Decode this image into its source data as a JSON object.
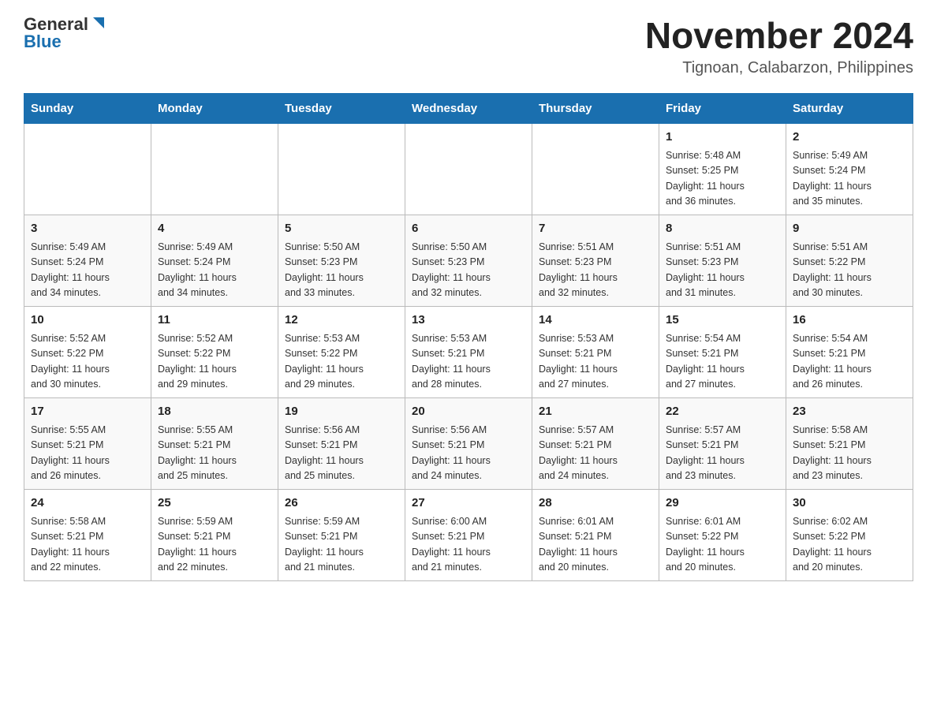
{
  "header": {
    "logo_general": "General",
    "logo_blue": "Blue",
    "main_title": "November 2024",
    "subtitle": "Tignoan, Calabarzon, Philippines"
  },
  "days_of_week": [
    "Sunday",
    "Monday",
    "Tuesday",
    "Wednesday",
    "Thursday",
    "Friday",
    "Saturday"
  ],
  "weeks": [
    {
      "days": [
        {
          "num": "",
          "info": ""
        },
        {
          "num": "",
          "info": ""
        },
        {
          "num": "",
          "info": ""
        },
        {
          "num": "",
          "info": ""
        },
        {
          "num": "",
          "info": ""
        },
        {
          "num": "1",
          "info": "Sunrise: 5:48 AM\nSunset: 5:25 PM\nDaylight: 11 hours\nand 36 minutes."
        },
        {
          "num": "2",
          "info": "Sunrise: 5:49 AM\nSunset: 5:24 PM\nDaylight: 11 hours\nand 35 minutes."
        }
      ]
    },
    {
      "days": [
        {
          "num": "3",
          "info": "Sunrise: 5:49 AM\nSunset: 5:24 PM\nDaylight: 11 hours\nand 34 minutes."
        },
        {
          "num": "4",
          "info": "Sunrise: 5:49 AM\nSunset: 5:24 PM\nDaylight: 11 hours\nand 34 minutes."
        },
        {
          "num": "5",
          "info": "Sunrise: 5:50 AM\nSunset: 5:23 PM\nDaylight: 11 hours\nand 33 minutes."
        },
        {
          "num": "6",
          "info": "Sunrise: 5:50 AM\nSunset: 5:23 PM\nDaylight: 11 hours\nand 32 minutes."
        },
        {
          "num": "7",
          "info": "Sunrise: 5:51 AM\nSunset: 5:23 PM\nDaylight: 11 hours\nand 32 minutes."
        },
        {
          "num": "8",
          "info": "Sunrise: 5:51 AM\nSunset: 5:23 PM\nDaylight: 11 hours\nand 31 minutes."
        },
        {
          "num": "9",
          "info": "Sunrise: 5:51 AM\nSunset: 5:22 PM\nDaylight: 11 hours\nand 30 minutes."
        }
      ]
    },
    {
      "days": [
        {
          "num": "10",
          "info": "Sunrise: 5:52 AM\nSunset: 5:22 PM\nDaylight: 11 hours\nand 30 minutes."
        },
        {
          "num": "11",
          "info": "Sunrise: 5:52 AM\nSunset: 5:22 PM\nDaylight: 11 hours\nand 29 minutes."
        },
        {
          "num": "12",
          "info": "Sunrise: 5:53 AM\nSunset: 5:22 PM\nDaylight: 11 hours\nand 29 minutes."
        },
        {
          "num": "13",
          "info": "Sunrise: 5:53 AM\nSunset: 5:21 PM\nDaylight: 11 hours\nand 28 minutes."
        },
        {
          "num": "14",
          "info": "Sunrise: 5:53 AM\nSunset: 5:21 PM\nDaylight: 11 hours\nand 27 minutes."
        },
        {
          "num": "15",
          "info": "Sunrise: 5:54 AM\nSunset: 5:21 PM\nDaylight: 11 hours\nand 27 minutes."
        },
        {
          "num": "16",
          "info": "Sunrise: 5:54 AM\nSunset: 5:21 PM\nDaylight: 11 hours\nand 26 minutes."
        }
      ]
    },
    {
      "days": [
        {
          "num": "17",
          "info": "Sunrise: 5:55 AM\nSunset: 5:21 PM\nDaylight: 11 hours\nand 26 minutes."
        },
        {
          "num": "18",
          "info": "Sunrise: 5:55 AM\nSunset: 5:21 PM\nDaylight: 11 hours\nand 25 minutes."
        },
        {
          "num": "19",
          "info": "Sunrise: 5:56 AM\nSunset: 5:21 PM\nDaylight: 11 hours\nand 25 minutes."
        },
        {
          "num": "20",
          "info": "Sunrise: 5:56 AM\nSunset: 5:21 PM\nDaylight: 11 hours\nand 24 minutes."
        },
        {
          "num": "21",
          "info": "Sunrise: 5:57 AM\nSunset: 5:21 PM\nDaylight: 11 hours\nand 24 minutes."
        },
        {
          "num": "22",
          "info": "Sunrise: 5:57 AM\nSunset: 5:21 PM\nDaylight: 11 hours\nand 23 minutes."
        },
        {
          "num": "23",
          "info": "Sunrise: 5:58 AM\nSunset: 5:21 PM\nDaylight: 11 hours\nand 23 minutes."
        }
      ]
    },
    {
      "days": [
        {
          "num": "24",
          "info": "Sunrise: 5:58 AM\nSunset: 5:21 PM\nDaylight: 11 hours\nand 22 minutes."
        },
        {
          "num": "25",
          "info": "Sunrise: 5:59 AM\nSunset: 5:21 PM\nDaylight: 11 hours\nand 22 minutes."
        },
        {
          "num": "26",
          "info": "Sunrise: 5:59 AM\nSunset: 5:21 PM\nDaylight: 11 hours\nand 21 minutes."
        },
        {
          "num": "27",
          "info": "Sunrise: 6:00 AM\nSunset: 5:21 PM\nDaylight: 11 hours\nand 21 minutes."
        },
        {
          "num": "28",
          "info": "Sunrise: 6:01 AM\nSunset: 5:21 PM\nDaylight: 11 hours\nand 20 minutes."
        },
        {
          "num": "29",
          "info": "Sunrise: 6:01 AM\nSunset: 5:22 PM\nDaylight: 11 hours\nand 20 minutes."
        },
        {
          "num": "30",
          "info": "Sunrise: 6:02 AM\nSunset: 5:22 PM\nDaylight: 11 hours\nand 20 minutes."
        }
      ]
    }
  ]
}
